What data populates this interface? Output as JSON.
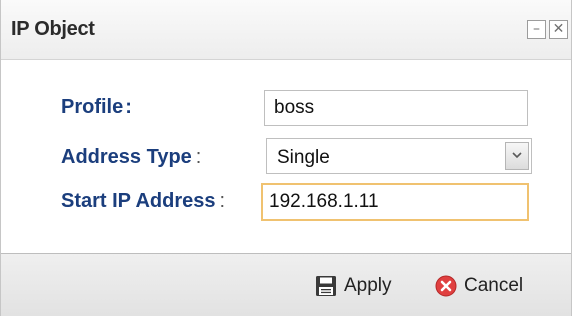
{
  "dialog": {
    "title": "IP Object",
    "minimize_glyph": "–",
    "close_glyph": "✕"
  },
  "form": {
    "profile_label": "Profile",
    "profile_value": "boss",
    "address_type_label": "Address Type",
    "address_type_value": "Single",
    "start_ip_label": "Start IP Address",
    "start_ip_value": "192.168.1.11",
    "colon": ":"
  },
  "footer": {
    "apply_label": "Apply",
    "cancel_label": "Cancel"
  },
  "icons": {
    "apply": "save-icon",
    "cancel": "cancel-icon",
    "dropdown": "chevron-down-icon"
  },
  "colors": {
    "label_text": "#1b3e7d",
    "focus_border": "#f0c270",
    "cancel_icon": "#e04040"
  }
}
